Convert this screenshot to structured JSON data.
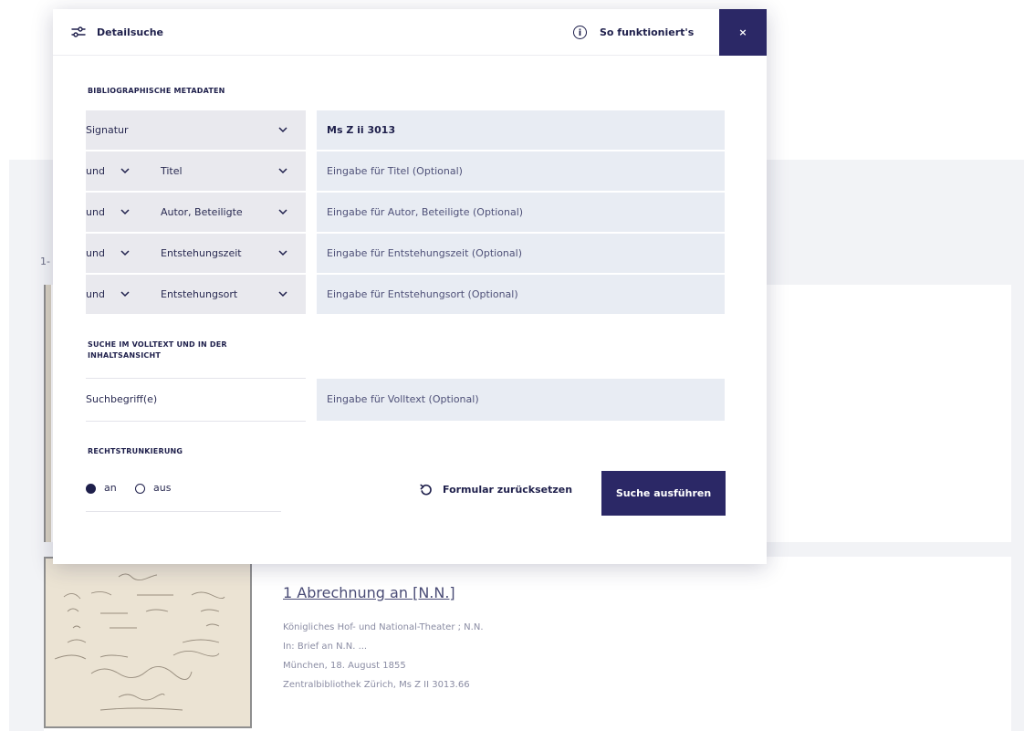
{
  "modal": {
    "title": "Detailsuche",
    "help_label": "So funktioniert's",
    "info_icon_glyph": "i",
    "close_label": "×"
  },
  "bibliographic": {
    "section_label": "BIBLIOGRAPHISCHE METADATEN",
    "rows": [
      {
        "operator": "",
        "field": "Signatur",
        "value": "Ms Z ii 3013",
        "placeholder": ""
      },
      {
        "operator": "und",
        "field": "Titel",
        "value": "",
        "placeholder": "Eingabe für Titel (Optional)"
      },
      {
        "operator": "und",
        "field": "Autor, Beteiligte",
        "value": "",
        "placeholder": "Eingabe für Autor, Beteiligte (Optional)"
      },
      {
        "operator": "und",
        "field": "Entstehungszeit",
        "value": "",
        "placeholder": "Eingabe für Entstehungszeit (Optional)"
      },
      {
        "operator": "und",
        "field": "Entstehungsort",
        "value": "",
        "placeholder": "Eingabe für Entstehungsort (Optional)"
      }
    ]
  },
  "fulltext": {
    "section_label_line1": "SUCHE IM VOLLTEXT UND IN DER",
    "section_label_line2": "INHALTSANSICHT",
    "left_label": "Suchbegriff(e)",
    "placeholder": "Eingabe für Volltext (Optional)"
  },
  "truncation": {
    "section_label": "RECHTSTRUNKIERUNG",
    "options": [
      {
        "label": "an",
        "selected": true
      },
      {
        "label": "aus",
        "selected": false
      }
    ]
  },
  "actions": {
    "reset_label": "Formular zurücksetzen",
    "search_label": "Suche ausführen"
  },
  "background": {
    "result_count_prefix": "1-",
    "result": {
      "title": "1 Abrechnung an [N.N.]",
      "line1": "Königliches Hof- und National-Theater ; N.N.",
      "line2": "In: Brief an N.N. ...",
      "line3": "München, 18. August 1855",
      "line4": "Zentralbibliothek Zürich, Ms Z II 3013.66"
    }
  },
  "colors": {
    "accent": "#2b2866",
    "text": "#1e1f4b",
    "field_bg": "#e8ecf3",
    "select_bg": "#e9e9ee"
  }
}
